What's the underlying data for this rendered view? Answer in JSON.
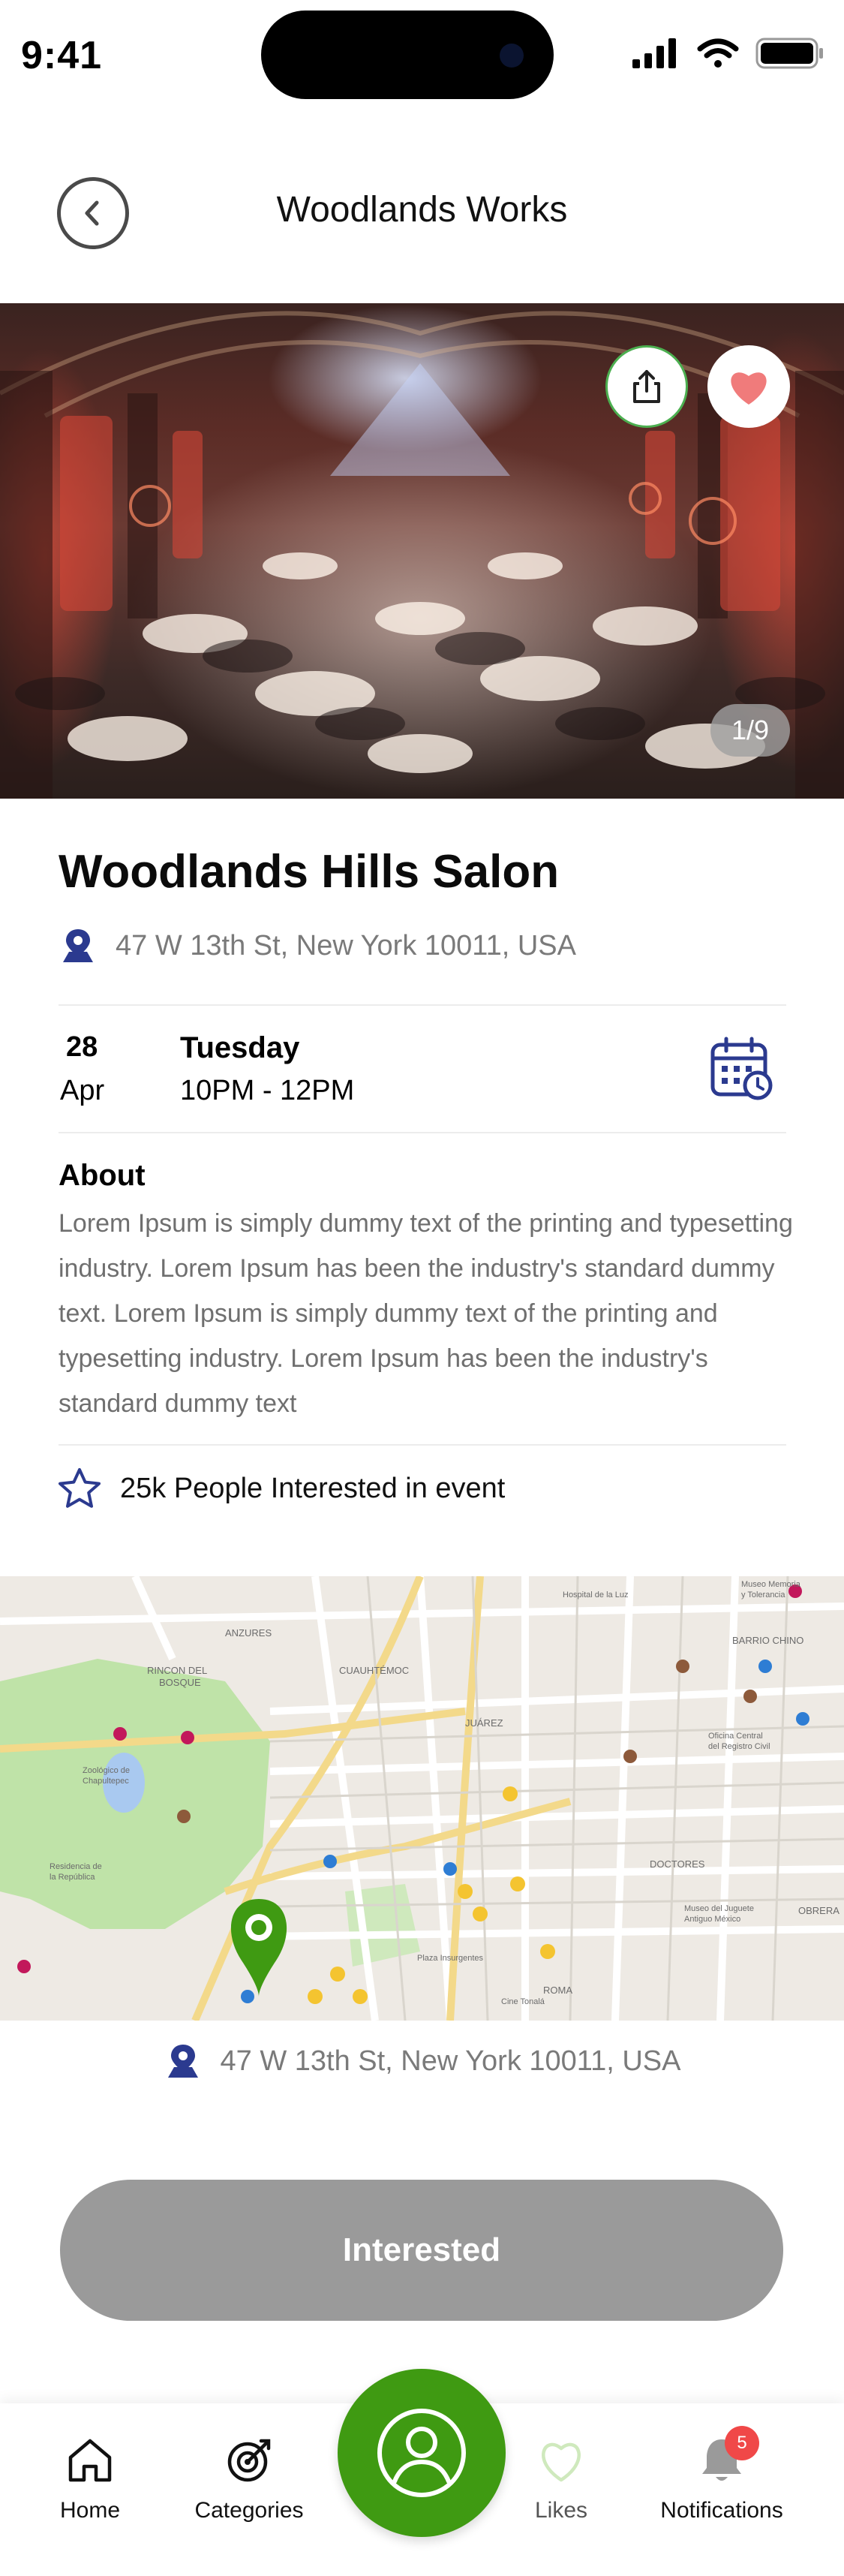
{
  "status_bar": {
    "time": "9:41"
  },
  "header": {
    "title": "Woodlands Works"
  },
  "hero": {
    "image_counter": "1/9"
  },
  "event": {
    "title": "Woodlands Hills Salon",
    "address": "47 W 13th St, New York 10011, USA",
    "date": {
      "day": "28",
      "month": "Apr",
      "weekday": "Tuesday",
      "time": "10PM - 12PM"
    },
    "about": {
      "title": "About",
      "text": "Lorem Ipsum is simply dummy text of the printing and typesetting industry. Lorem Ipsum has been the industry's standard dummy text. Lorem Ipsum is simply dummy text of the printing and typesetting industry. Lorem Ipsum has been the industry's standard dummy text"
    },
    "interested_text": "25k People Interested in event"
  },
  "map": {
    "address": "47 W 13th St, New York 10011, USA",
    "labels": [
      "ANZURES",
      "RINCON DEL BOSQUE",
      "CUAUHTÉMOC",
      "JUÁREZ",
      "DOCTORES",
      "BARRIO CHINO",
      "ROMA",
      "OBRERA",
      "Zoológico de Chapultepec",
      "Residencia de la República",
      "Plaza Insurgentes",
      "Museo del Juguete Antiguo México",
      "Museo Memoria y Tolerancia",
      "Hospital de la Luz",
      "Oficina Central del Registro Civil",
      "Cine Tonalá"
    ]
  },
  "cta": {
    "label": "Interested"
  },
  "nav": {
    "home": "Home",
    "categories": "Categories",
    "likes": "Likes",
    "notifications": "Notifications",
    "notifications_badge": "5"
  },
  "colors": {
    "primary_green": "#3f9a12",
    "accent_blue": "#2b3a8f",
    "like_pink": "#f07b7b",
    "button_grey": "#9a9a9a",
    "badge_red": "#f04848"
  },
  "icons": [
    "back-arrow-icon",
    "share-icon",
    "heart-icon",
    "location-pin-icon",
    "calendar-clock-icon",
    "star-icon",
    "home-icon",
    "categories-icon",
    "profile-icon",
    "heart-outline-icon",
    "bell-icon"
  ]
}
